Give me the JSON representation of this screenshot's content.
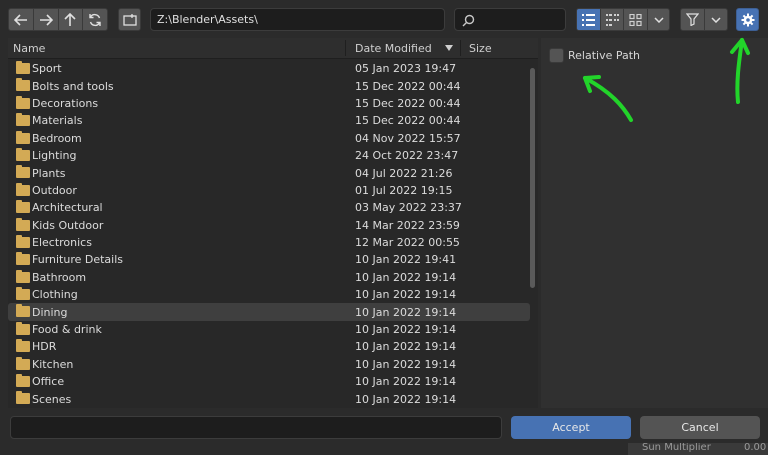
{
  "toolbar": {
    "path": "Z:\\Blender\\Assets\\",
    "search_placeholder": ""
  },
  "file_list": {
    "columns": {
      "name": "Name",
      "date": "Date Modified",
      "size": "Size"
    },
    "rows": [
      {
        "name": "Sport",
        "date": "05 Jan 2023 19:47"
      },
      {
        "name": "Bolts and tools",
        "date": "15 Dec 2022 00:44"
      },
      {
        "name": "Decorations",
        "date": "15 Dec 2022 00:44"
      },
      {
        "name": "Materials",
        "date": "15 Dec 2022 00:44"
      },
      {
        "name": "Bedroom",
        "date": "04 Nov 2022 15:57"
      },
      {
        "name": "Lighting",
        "date": "24 Oct 2022 23:47"
      },
      {
        "name": "Plants",
        "date": "04 Jul 2022 21:26"
      },
      {
        "name": "Outdoor",
        "date": "01 Jul 2022 19:15"
      },
      {
        "name": "Architectural",
        "date": "03 May 2022 23:37"
      },
      {
        "name": "Kids Outdoor",
        "date": "14 Mar 2022 23:59"
      },
      {
        "name": "Electronics",
        "date": "12 Mar 2022 00:55"
      },
      {
        "name": "Furniture Details",
        "date": "10 Jan 2022 19:41"
      },
      {
        "name": "Bathroom",
        "date": "10 Jan 2022 19:14"
      },
      {
        "name": "Clothing",
        "date": "10 Jan 2022 19:14"
      },
      {
        "name": "Dining",
        "date": "10 Jan 2022 19:14",
        "selected": true
      },
      {
        "name": "Food & drink",
        "date": "10 Jan 2022 19:14"
      },
      {
        "name": "HDR",
        "date": "10 Jan 2022 19:14"
      },
      {
        "name": "Kitchen",
        "date": "10 Jan 2022 19:14"
      },
      {
        "name": "Office",
        "date": "10 Jan 2022 19:14"
      },
      {
        "name": "Scenes",
        "date": "10 Jan 2022 19:14"
      }
    ]
  },
  "side_panel": {
    "relative_path_label": "Relative Path",
    "relative_path_checked": false
  },
  "footer": {
    "filename_value": "",
    "accept_label": "Accept",
    "cancel_label": "Cancel",
    "background_text": "Sun Multiplier",
    "background_value": "0.00"
  },
  "colors": {
    "accent": "#4772b3",
    "folder": "#d3aa55",
    "annotation": "#22d42a"
  }
}
